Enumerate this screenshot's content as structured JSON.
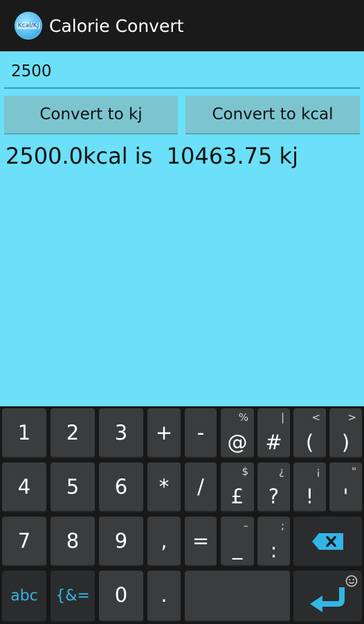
{
  "app": {
    "title": "Calorie Convert",
    "icon_text": "Kcal/KJ"
  },
  "input": {
    "value": "2500"
  },
  "buttons": {
    "to_kj": "Convert to kj",
    "to_kcal": "Convert to kcal"
  },
  "result": {
    "text": "2500.0kcal is  10463.75 kj"
  },
  "keyboard": {
    "rows": [
      [
        {
          "main": "1"
        },
        {
          "main": "2"
        },
        {
          "main": "3"
        },
        {
          "main": "+"
        },
        {
          "main": "-"
        },
        {
          "main": "@",
          "sub": "%"
        },
        {
          "main": "#",
          "sub": "|"
        },
        {
          "main": "(",
          "sub": "<"
        },
        {
          "main": ")",
          "sub": ">"
        }
      ],
      [
        {
          "main": "4"
        },
        {
          "main": "5"
        },
        {
          "main": "6"
        },
        {
          "main": "*"
        },
        {
          "main": "/"
        },
        {
          "main": "£",
          "sub": "$"
        },
        {
          "main": "?",
          "sub": "¿"
        },
        {
          "main": "!",
          "sub": "¡"
        },
        {
          "main": "'",
          "sub": "\""
        }
      ],
      [
        {
          "main": "7"
        },
        {
          "main": "8"
        },
        {
          "main": "9"
        },
        {
          "main": ","
        },
        {
          "main": "="
        },
        {
          "main": "_",
          "sub": "–"
        },
        {
          "main": ":",
          "sub": ";"
        }
      ],
      [
        {
          "main": "abc"
        },
        {
          "main": "{&="
        },
        {
          "main": "0"
        },
        {
          "main": "."
        }
      ]
    ],
    "icons": {
      "delete": "backspace-icon",
      "enter": "enter-icon",
      "emoji": "smiley-icon"
    },
    "accent_color": "#33b5e5"
  }
}
